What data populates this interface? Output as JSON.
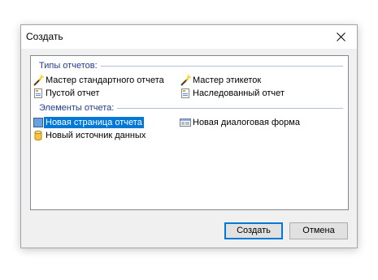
{
  "window": {
    "title": "Создать"
  },
  "groups": {
    "report_types": {
      "label": "Типы отчетов:",
      "items": [
        {
          "label": "Мастер стандартного отчета",
          "icon": "wand-icon"
        },
        {
          "label": "Мастер этикеток",
          "icon": "wand-icon"
        },
        {
          "label": "Пустой отчет",
          "icon": "blank-report-icon"
        },
        {
          "label": "Наследованный отчет",
          "icon": "inherited-report-icon"
        }
      ]
    },
    "report_elements": {
      "label": "Элементы отчета:",
      "items": [
        {
          "label": "Новая страница отчета",
          "icon": "report-page-icon",
          "selected": true
        },
        {
          "label": "Новая диалоговая форма",
          "icon": "dialog-form-icon"
        },
        {
          "label": "Новый источник данных",
          "icon": "database-icon"
        }
      ]
    }
  },
  "buttons": {
    "create": "Создать",
    "cancel": "Отмена"
  },
  "colors": {
    "selection": "#0078d7",
    "group_header_text": "#1e3d8f"
  }
}
